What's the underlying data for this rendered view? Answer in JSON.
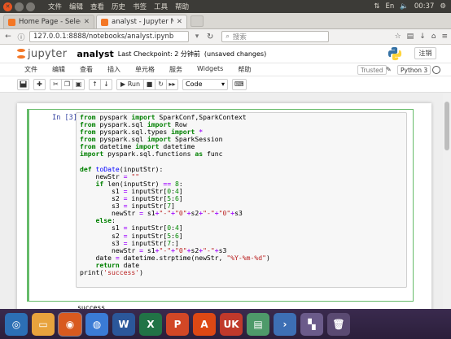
{
  "os_bar": {
    "menus": [
      "文件",
      "编辑",
      "查看",
      "历史",
      "书签",
      "工具",
      "帮助"
    ],
    "clock": "00:37"
  },
  "browser": {
    "tabs": [
      {
        "title": "Home Page - Select ...",
        "active": false
      },
      {
        "title": "analyst - Jupyter No...",
        "active": true
      }
    ],
    "url": "127.0.0.1:8888/notebooks/analyst.ipynb",
    "search_placeholder": "搜索"
  },
  "jupyter": {
    "logo_text": "jupyter",
    "notebook_name": "analyst",
    "checkpoint": "Last Checkpoint: 2 分钟前",
    "unsaved": "(unsaved changes)",
    "logout_label": "注销",
    "menus": [
      "文件",
      "编辑",
      "查看",
      "插入",
      "单元格",
      "服务",
      "Widgets",
      "帮助"
    ],
    "trusted_label": "Trusted",
    "kernel_label": "Python 3",
    "toolbar": {
      "run_label": "Run",
      "cell_type": "Code"
    }
  },
  "cell": {
    "prompt": "In [3]:",
    "output": "success"
  },
  "colors": {
    "jupyter_orange": "#f37726",
    "cell_border": "#66bb6a",
    "prompt_color": "#303f9f"
  }
}
